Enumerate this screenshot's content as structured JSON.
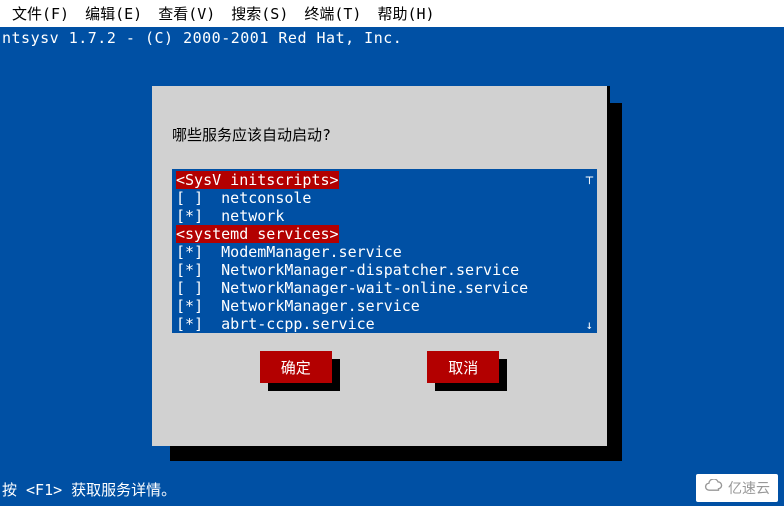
{
  "menu": {
    "items": [
      "文件(F)",
      "编辑(E)",
      "查看(V)",
      "搜索(S)",
      "终端(T)",
      "帮助(H)"
    ]
  },
  "topline": "ntsysv 1.7.2 - (C) 2000-2001 Red Hat, Inc.",
  "dialog": {
    "title": "哪些服务应该自动启动?",
    "headers": {
      "sysv": "<SysV initscripts>",
      "systemd": "<systemd services>"
    },
    "services": [
      {
        "mark": " ",
        "name": "netconsole"
      },
      {
        "mark": "*",
        "name": "network"
      }
    ],
    "systemd_services": [
      {
        "mark": "*",
        "name": "ModemManager.service"
      },
      {
        "mark": "*",
        "name": "NetworkManager-dispatcher.service"
      },
      {
        "mark": " ",
        "name": "NetworkManager-wait-online.service"
      },
      {
        "mark": "*",
        "name": "NetworkManager.service"
      },
      {
        "mark": "*",
        "name": "abrt-ccpp.service"
      }
    ],
    "buttons": {
      "ok": "确定",
      "cancel": "取消"
    }
  },
  "footer": "按 <F1> 获取服务详情。",
  "watermark": "亿速云",
  "colors": {
    "bg": "#0050a4",
    "panel": "#d1d1d1",
    "accent": "#b30000"
  }
}
